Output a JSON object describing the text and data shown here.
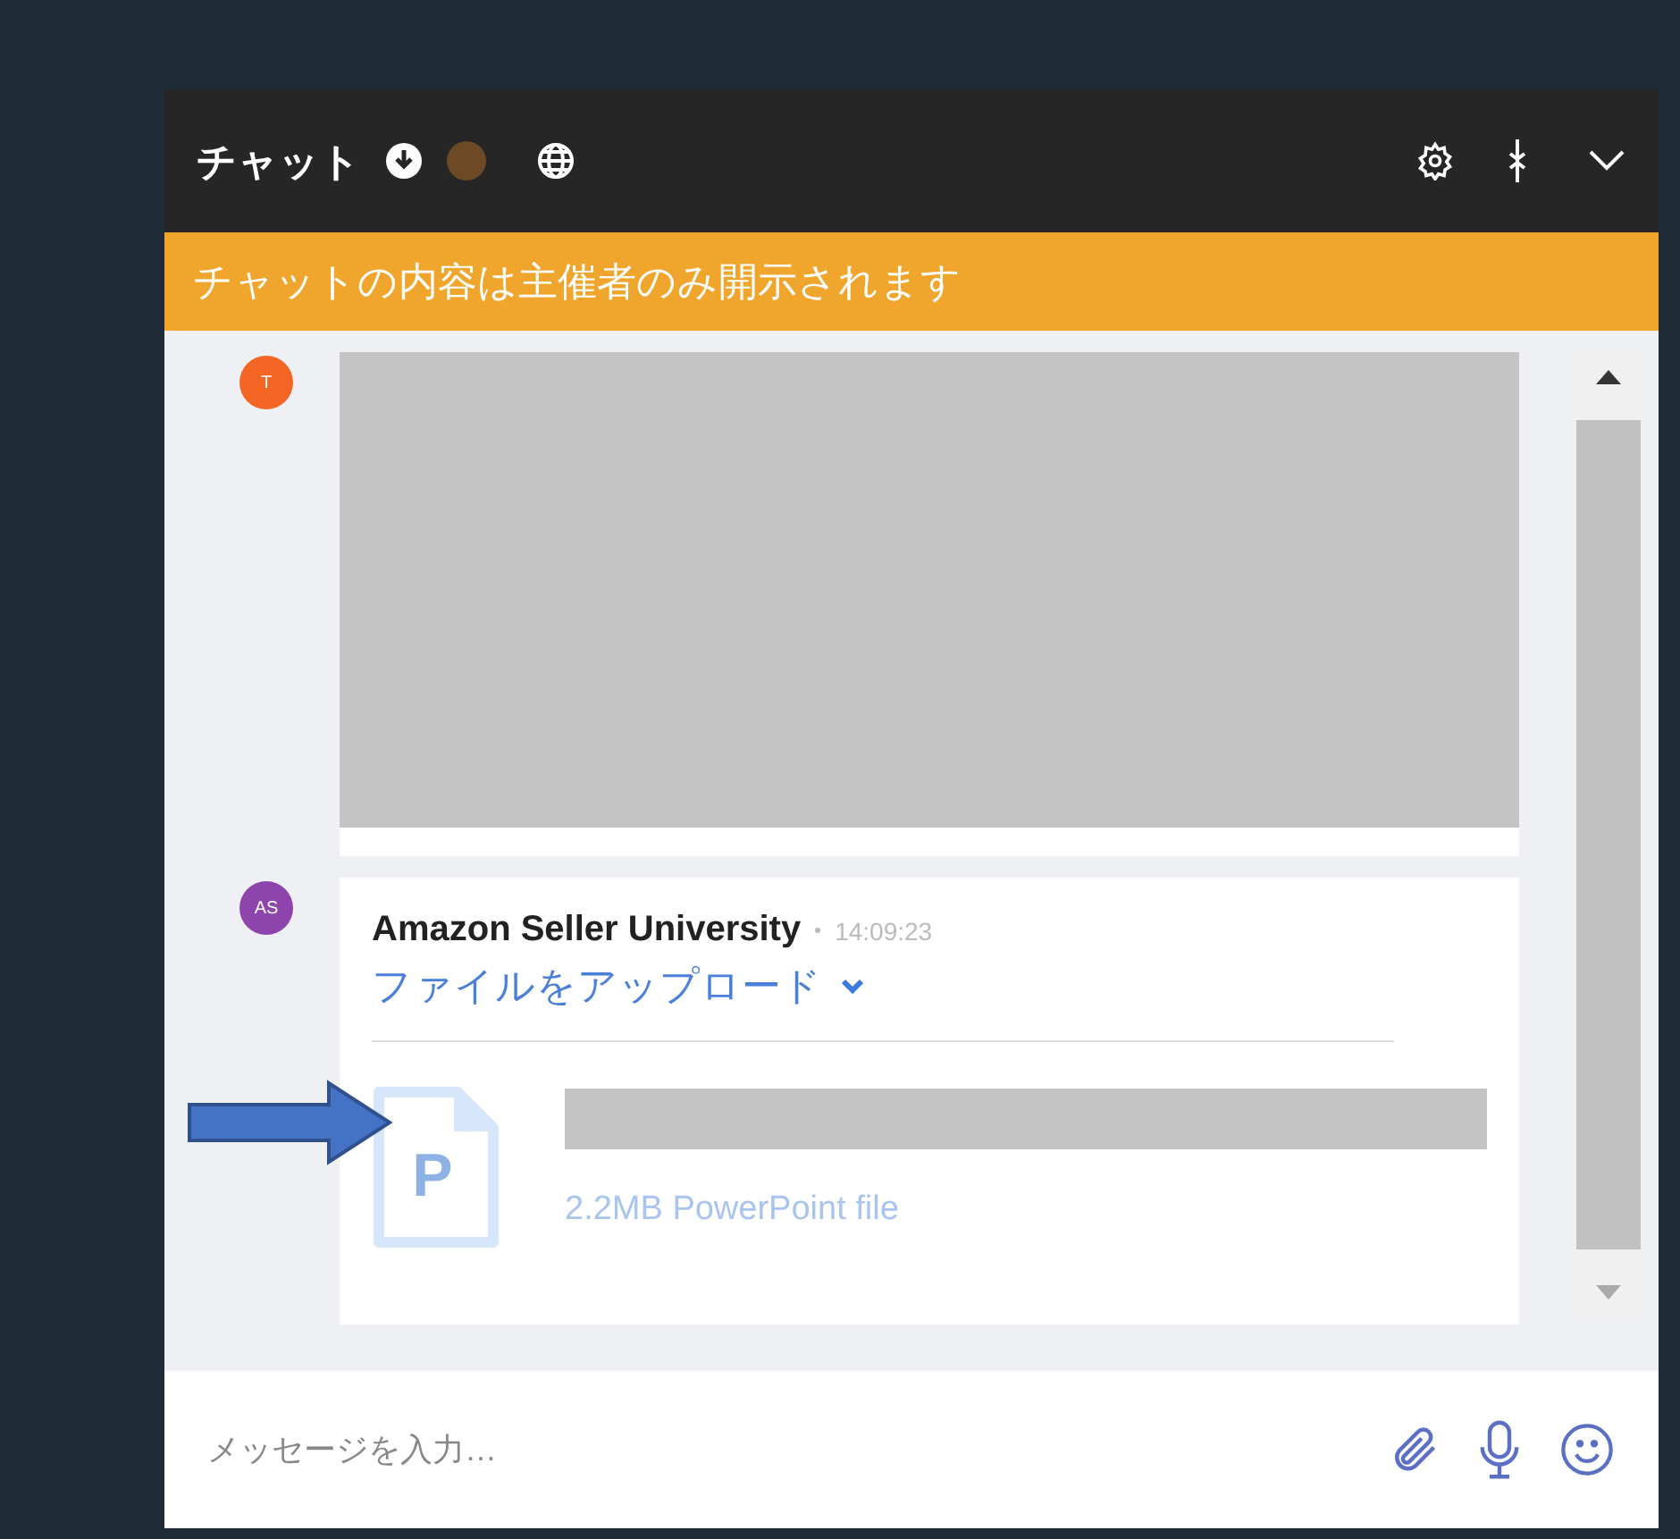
{
  "header": {
    "title": "チャット"
  },
  "banner": {
    "text": "チャットの内容は主催者のみ開示されます"
  },
  "messages": [
    {
      "kind": "redacted",
      "avatar": "T",
      "color": "#f26522"
    },
    {
      "kind": "file",
      "avatar": "AS",
      "color": "#8e44ad",
      "sender": "Amazon Seller University",
      "time": "14:09:23",
      "action": "ファイルをアップロード",
      "file_letter": "P",
      "file_info": "2.2MB PowerPoint file"
    }
  ],
  "composer": {
    "placeholder": "メッセージを入力…"
  }
}
